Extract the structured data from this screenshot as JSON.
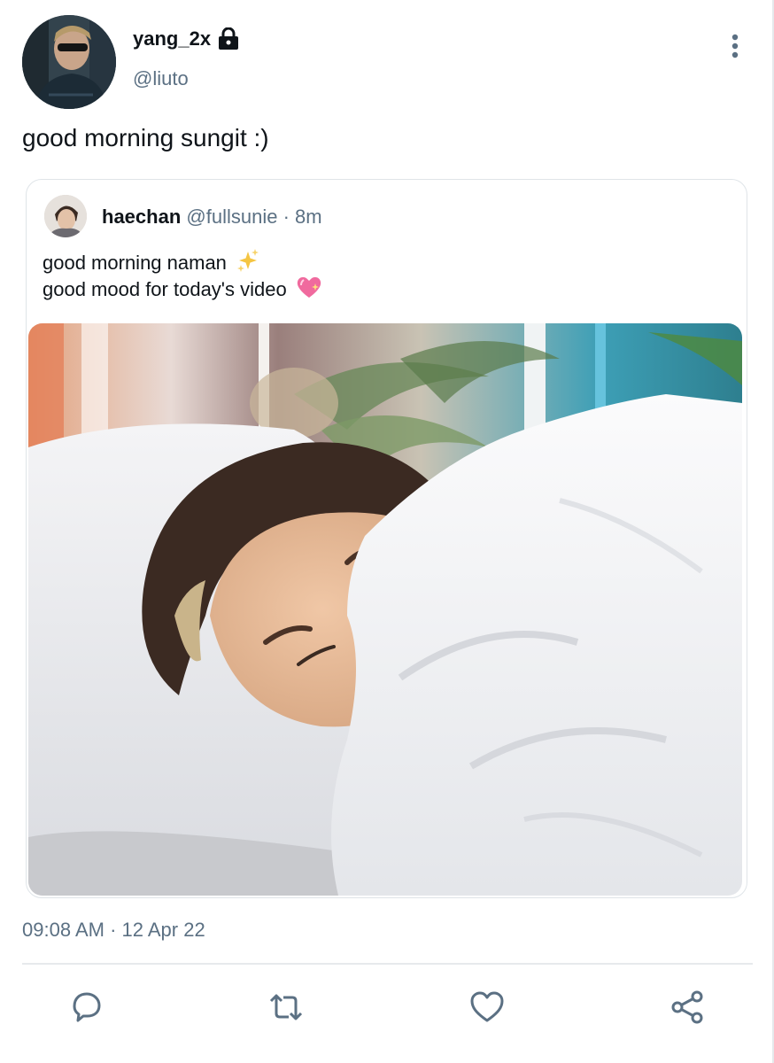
{
  "author": {
    "display_name": "yang_2x",
    "handle": "@liuto",
    "protected_icon": "lock-icon"
  },
  "tweet": {
    "text": "good morning sungit :)",
    "timestamp": "09:08 AM · 12 Apr 22"
  },
  "quoted": {
    "display_name": "haechan",
    "handle": "@fullsunie",
    "time": "8m",
    "line1": "good morning naman",
    "line1_emoji": "sparkles-emoji",
    "line2": "good mood for today's video",
    "line2_emoji": "sparkling-heart-emoji",
    "media": "photo"
  },
  "actions": [
    "reply-icon",
    "retweet-icon",
    "like-icon",
    "share-icon"
  ],
  "colors": {
    "secondary_text": "#5b7083",
    "primary_text": "#0f1419",
    "border": "#dfe4e8"
  }
}
